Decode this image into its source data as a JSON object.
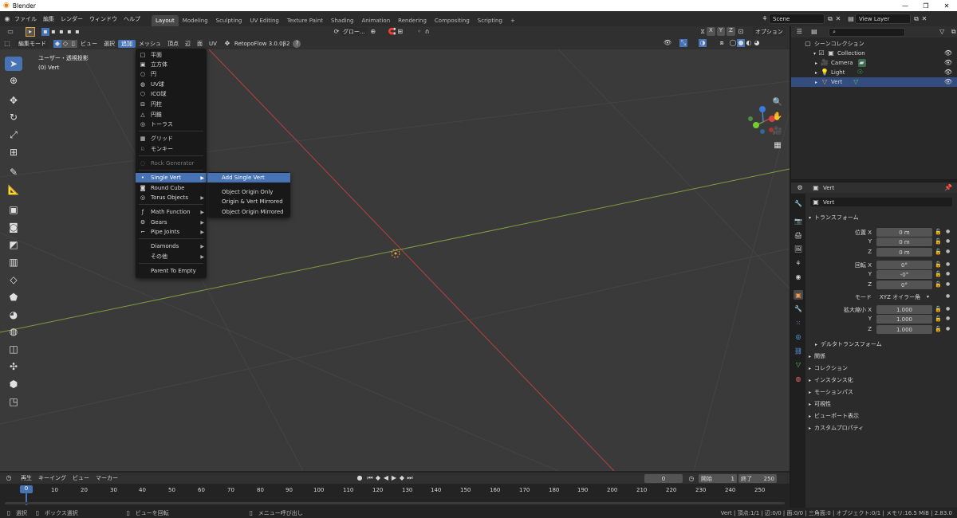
{
  "window": {
    "title": "Blender",
    "controls": [
      "—",
      "❐",
      "✕"
    ]
  },
  "topmenu": [
    "ファイル",
    "編集",
    "レンダー",
    "ウィンドウ",
    "ヘルプ"
  ],
  "workspaces": [
    {
      "label": "Layout",
      "active": true
    },
    {
      "label": "Modeling"
    },
    {
      "label": "Sculpting"
    },
    {
      "label": "UV Editing"
    },
    {
      "label": "Texture Paint"
    },
    {
      "label": "Shading"
    },
    {
      "label": "Animation"
    },
    {
      "label": "Rendering"
    },
    {
      "label": "Compositing"
    },
    {
      "label": "Scripting"
    }
  ],
  "add_workspace": "+",
  "scene": "Scene",
  "view_layer": "View Layer",
  "header": {
    "mode": "編集モード",
    "menus": [
      "ビュー",
      "選択",
      "追加",
      "メッシュ",
      "頂点",
      "辺",
      "面",
      "UV"
    ],
    "active_menu": "追加",
    "addon": "RetopoFlow 3.0.0β2",
    "transform_orientation": "グロー...",
    "axes": [
      "X",
      "Y",
      "Z"
    ],
    "options": "オプション"
  },
  "viewport": {
    "view_name": "ユーザー・透視投影",
    "object_name": "(0) Vert"
  },
  "add_menu": {
    "items": [
      {
        "label": "平面",
        "icon": "□"
      },
      {
        "label": "立方体",
        "icon": "▣"
      },
      {
        "label": "円",
        "icon": "○"
      },
      {
        "label": "UV球",
        "icon": "◍"
      },
      {
        "label": "ICO球",
        "icon": "⬡"
      },
      {
        "label": "円柱",
        "icon": "⊟"
      },
      {
        "label": "円錐",
        "icon": "△"
      },
      {
        "label": "トーラス",
        "icon": "◎"
      },
      {
        "label": "グリッド",
        "icon": "▦"
      },
      {
        "label": "モンキー",
        "icon": "♘"
      },
      {
        "label": "Rock Generator",
        "icon": "◌"
      },
      {
        "label": "Single Vert",
        "icon": "•"
      },
      {
        "label": "Round Cube",
        "icon": "◙"
      },
      {
        "label": "Torus Objects",
        "icon": "◎"
      },
      {
        "label": "Math Function",
        "icon": "ƒ"
      },
      {
        "label": "Gears",
        "icon": "⚙"
      },
      {
        "label": "Pipe Joints",
        "icon": "⌐"
      },
      {
        "label": "Diamonds",
        "icon": ""
      },
      {
        "label": "その他",
        "icon": ""
      },
      {
        "label": "Parent To Empty",
        "icon": ""
      }
    ]
  },
  "submenu": {
    "items": [
      "Add Single Vert",
      "Object Origin Only",
      "Origin & Vert Mirrored",
      "Object Origin Mirrored"
    ]
  },
  "outliner": {
    "root": "シーンコレクション",
    "collection": "Collection",
    "objects": [
      "Camera",
      "Light",
      "Vert"
    ]
  },
  "properties": {
    "object": "Vert",
    "object_field": "Vert",
    "transform_title": "トランスフォーム",
    "location_label": "位置 X",
    "rotation_label": "回転 X",
    "mode_label": "モード",
    "scale_label": "拡大縮小 X",
    "y": "Y",
    "z": "Z",
    "loc": [
      "0 m",
      "0 m",
      "0 m"
    ],
    "rot": [
      "0°",
      "-0°",
      "0°"
    ],
    "mode": "XYZ オイラー角",
    "scale": [
      "1.000",
      "1.000",
      "1.000"
    ],
    "panels": [
      "デルタトランスフォーム",
      "関係",
      "コレクション",
      "インスタンス化",
      "モーションパス",
      "可視性",
      "ビューポート表示",
      "カスタムプロパティ"
    ]
  },
  "timeline": {
    "menus": [
      "再生",
      "キーイング",
      "ビュー",
      "マーカー"
    ],
    "current_frame": "0",
    "start_label": "開始",
    "start": "1",
    "end_label": "終了",
    "end": "250",
    "ticks": [
      "0",
      "10",
      "20",
      "30",
      "40",
      "50",
      "60",
      "70",
      "80",
      "90",
      "100",
      "110",
      "120",
      "130",
      "140",
      "150",
      "160",
      "170",
      "180",
      "190",
      "200",
      "210",
      "220",
      "230",
      "240",
      "250"
    ]
  },
  "status": {
    "left": [
      "選択",
      "ボックス選択",
      "ビューを回転",
      "メニュー呼び出し"
    ],
    "right": "Vert | 頂点:1/1 | 辺:0/0 | 面:0/0 | 三角面:0 | オブジェクト:0/1 | メモリ:16.5 MiB | 2.83.0"
  }
}
